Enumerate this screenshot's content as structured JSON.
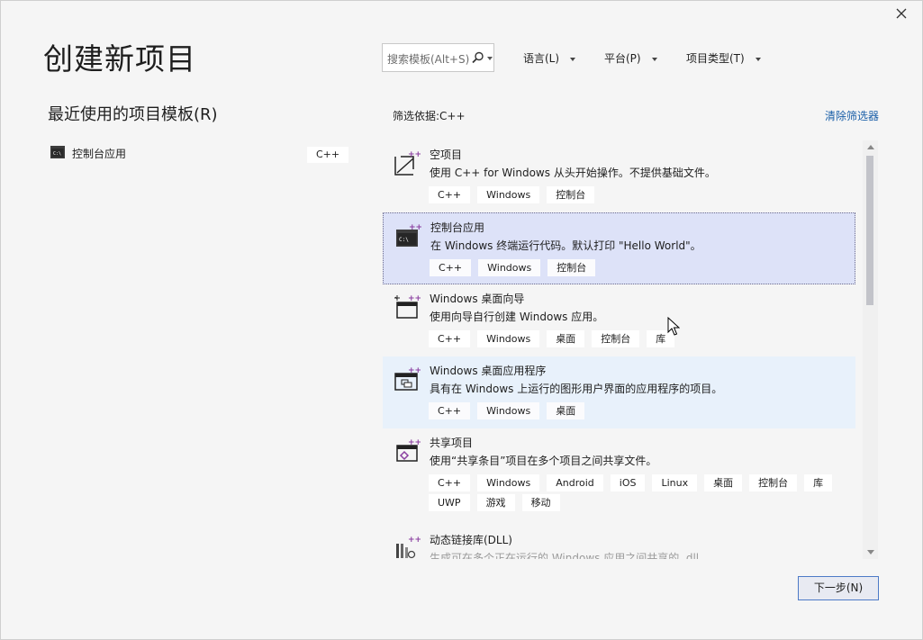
{
  "window": {
    "close_icon": "close-icon"
  },
  "page_title": "创建新项目",
  "recent": {
    "title": "最近使用的项目模板(R)",
    "items": [
      {
        "label": "控制台应用",
        "tag": "C++",
        "icon": "console-app-icon"
      }
    ]
  },
  "search": {
    "placeholder": "搜索模板(Alt+S)",
    "icon": "search-icon"
  },
  "filters": {
    "language": "语言(L)",
    "platform": "平台(P)",
    "project_type": "项目类型(T)"
  },
  "filter_label": "筛选依据:C++",
  "clear_filters": "清除筛选器",
  "templates": [
    {
      "name": "空项目",
      "desc": "使用 C++ for Windows 从头开始操作。不提供基础文件。",
      "tags": [
        "C++",
        "Windows",
        "控制台"
      ],
      "icon": "empty-project-icon"
    },
    {
      "name": "控制台应用",
      "desc": "在 Windows 终端运行代码。默认打印 \"Hello World\"。",
      "tags": [
        "C++",
        "Windows",
        "控制台"
      ],
      "icon": "console-app-icon"
    },
    {
      "name": "Windows 桌面向导",
      "desc": "使用向导自行创建 Windows 应用。",
      "tags": [
        "C++",
        "Windows",
        "桌面",
        "控制台",
        "库"
      ],
      "icon": "desktop-wizard-icon"
    },
    {
      "name": "Windows 桌面应用程序",
      "desc": "具有在 Windows 上运行的图形用户界面的应用程序的项目。",
      "tags": [
        "C++",
        "Windows",
        "桌面"
      ],
      "icon": "desktop-app-icon"
    },
    {
      "name": "共享项目",
      "desc": "使用“共享条目”项目在多个项目之间共享文件。",
      "tags": [
        "C++",
        "Windows",
        "Android",
        "iOS",
        "Linux",
        "桌面",
        "控制台",
        "库",
        "UWP",
        "游戏",
        "移动"
      ],
      "icon": "shared-project-icon"
    },
    {
      "name": "动态链接库(DLL)",
      "desc": "生成可在多个正在运行的 Windows 应用之间共享的 .dll。",
      "tags": [],
      "icon": "dll-icon"
    }
  ],
  "next_button": "下一步(N)",
  "colors": {
    "selected_bg": "#dde2f8",
    "hover_bg": "#e8f1fb",
    "link": "#1a5fa8",
    "accent_plus": "#8a3fa0",
    "button_border": "#4d7ac7"
  }
}
